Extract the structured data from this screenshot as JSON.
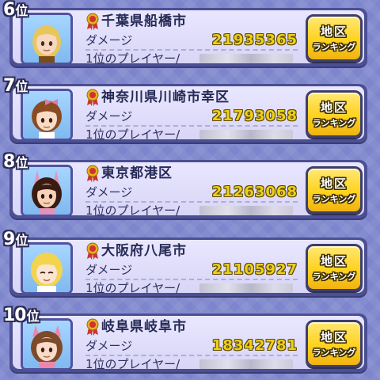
{
  "leaderboard": {
    "rows": [
      {
        "rank": "6",
        "rank_suffix": "位",
        "area": "千葉県船橋市",
        "damage_label": "ダメージ",
        "damage": "21935365",
        "player_label": "1位のプレイヤー/",
        "button_line1": "地区",
        "button_line2": "ランキング",
        "avatar": {
          "icon": "blonde-boy-avatar",
          "hair": "#e8c65a",
          "skin": "#f6d7bf",
          "accent": "#7c4b16"
        }
      },
      {
        "rank": "7",
        "rank_suffix": "位",
        "area": "神奈川県川崎市幸区",
        "damage_label": "ダメージ",
        "damage": "21793058",
        "player_label": "1位のプレイヤー/",
        "button_line1": "地区",
        "button_line2": "ランキング",
        "avatar": {
          "icon": "brown-hair-girl-avatar",
          "hair": "#8a4b22",
          "skin": "#f8dcc6",
          "accent": "#e07aa0"
        }
      },
      {
        "rank": "8",
        "rank_suffix": "位",
        "area": "東京都港区",
        "damage_label": "ダメージ",
        "damage": "21263068",
        "player_label": "1位のプレイヤー/",
        "button_line1": "地区",
        "button_line2": "ランキング",
        "avatar": {
          "icon": "dark-hair-bunny-girl-avatar",
          "hair": "#3a1b12",
          "skin": "#f6d2b9",
          "accent": "#e493b7"
        }
      },
      {
        "rank": "9",
        "rank_suffix": "位",
        "area": "大阪府八尾市",
        "damage_label": "ダメージ",
        "damage": "21105927",
        "player_label": "1位のプレイヤー/",
        "button_line1": "地区",
        "button_line2": "ランキング",
        "avatar": {
          "icon": "blonde-girl-avatar",
          "hair": "#f3d44f",
          "skin": "#fbe4d2",
          "accent": "#ffffff"
        }
      },
      {
        "rank": "10",
        "rank_suffix": "位",
        "area": "岐阜県岐阜市",
        "damage_label": "ダメージ",
        "damage": "18342781",
        "player_label": "1位のプレイヤー/",
        "button_line1": "地区",
        "button_line2": "ランキング",
        "avatar": {
          "icon": "brown-hair-bunny-girl-avatar",
          "hair": "#7d4a2a",
          "skin": "#f8dbc8",
          "accent": "#ee86a9"
        }
      }
    ]
  },
  "colors": {
    "background": "#7d86cc",
    "card_fill": "#e9e7ff",
    "damage_value": "#f0cf18",
    "button_gold": "#ffd21e"
  }
}
